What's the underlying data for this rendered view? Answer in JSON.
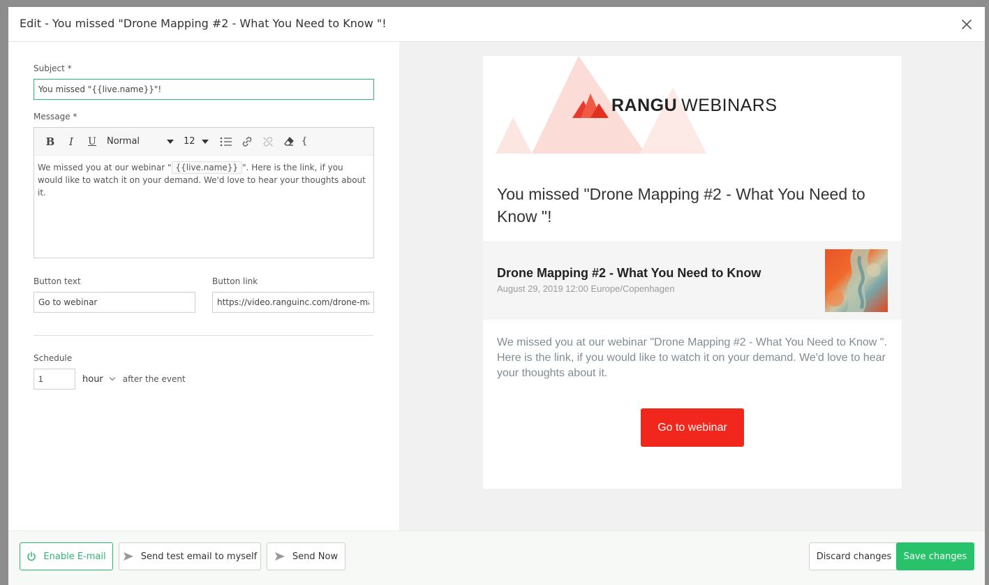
{
  "modal": {
    "title": "Edit - You missed \"Drone Mapping #2 - What You Need to Know \"!"
  },
  "form": {
    "subject_label": "Subject *",
    "subject_value": "You missed \"{{live.name}}\"!",
    "message_label": "Message *",
    "toolbar": {
      "format_value": "Normal",
      "size_value": "12"
    },
    "message": {
      "before": "We missed you at our webinar \"",
      "chip": "{{live.name}}",
      "after": "\". Here is the link, if you would like to watch it on your demand. We'd love to hear your thoughts about it."
    },
    "button_text_label": "Button text",
    "button_text_value": "Go to webinar",
    "button_link_label": "Button link",
    "button_link_value": "https://video.ranguinc.com/drone-mapping",
    "schedule_label": "Schedule",
    "schedule_value": "1",
    "schedule_unit": "hour",
    "schedule_after": "after  the event"
  },
  "preview": {
    "brand_bold": "RANGU",
    "brand_light": "WEBINARS",
    "heading": "You missed \"Drone Mapping #2 - What You Need to Know \"!",
    "event_title": "Drone Mapping #2 - What You Need to Know",
    "event_date": "August 29, 2019 12:00 Europe/Copenhagen",
    "body": "We missed you at our webinar \"Drone Mapping #2 - What You Need to Know \". Here is the link, if you would like to watch it on your demand. We'd love to hear your thoughts about it.",
    "cta_label": "Go to webinar"
  },
  "footer": {
    "enable_label": "Enable E-mail",
    "test_label": "Send test email to myself",
    "send_now_label": "Send Now",
    "discard_label": "Discard changes",
    "save_label": "Save changes"
  },
  "colors": {
    "accent_green": "#2fb673",
    "save_green": "#27c26a",
    "cta_red": "#f1261c",
    "brand_red": "#e83a2c"
  }
}
